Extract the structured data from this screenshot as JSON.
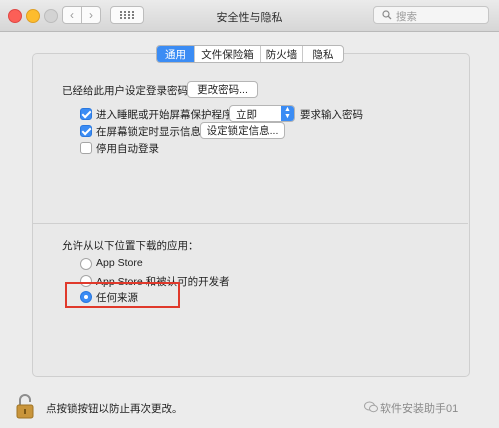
{
  "window": {
    "title": "安全性与隐私"
  },
  "search": {
    "placeholder": "搜索"
  },
  "tabs": [
    {
      "label": "通用",
      "active": true
    },
    {
      "label": "文件保险箱",
      "active": false
    },
    {
      "label": "防火墙",
      "active": false
    },
    {
      "label": "隐私",
      "active": false
    }
  ],
  "general": {
    "password_set_label": "已经给此用户设定登录密码",
    "change_password_button": "更改密码...",
    "require_password": {
      "checked": true,
      "label": "进入睡眠或开始屏幕保护程序",
      "select_value": "立即",
      "suffix": "要求输入密码"
    },
    "show_message": {
      "checked": true,
      "label": "在屏幕锁定时显示信息",
      "button": "设定锁定信息..."
    },
    "disable_autologin": {
      "checked": false,
      "label": "停用自动登录"
    }
  },
  "downloads": {
    "heading": "允许从以下位置下载的应用：",
    "options": [
      {
        "label": "App Store",
        "selected": false
      },
      {
        "label": "App Store 和被认可的开发者",
        "selected": false
      },
      {
        "label": "任何来源",
        "selected": true
      }
    ]
  },
  "footer": {
    "lock_text": "点按锁按钮以防止再次更改。"
  },
  "watermark": {
    "text": "软件安装助手01"
  },
  "colors": {
    "accent": "#3b8cf4",
    "highlight": "#e0392b"
  }
}
